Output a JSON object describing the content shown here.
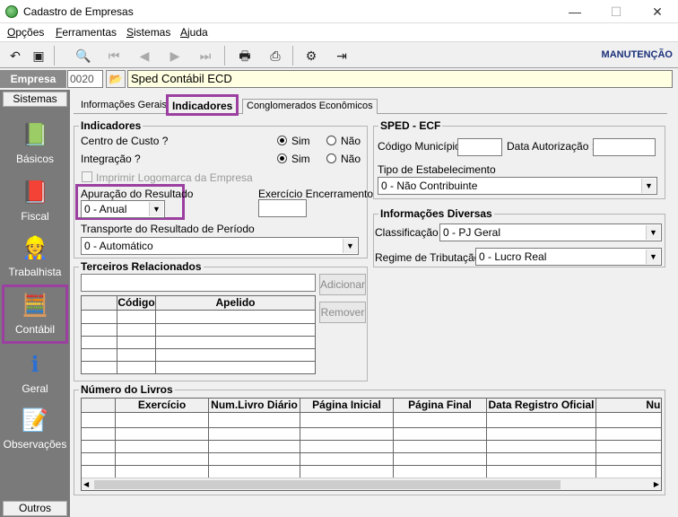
{
  "window": {
    "title": "Cadastro de Empresas",
    "minimize": "—",
    "maximize": "☐",
    "close": "✕"
  },
  "menu": [
    {
      "accel": "O",
      "rest": "pções"
    },
    {
      "accel": "F",
      "rest": "erramentas"
    },
    {
      "accel": "S",
      "rest": "istemas"
    },
    {
      "accel": "A",
      "rest": "juda"
    }
  ],
  "toolbar": {
    "mode": "MANUTENÇÃO"
  },
  "empresa": {
    "label": "Empresa",
    "code": "0020",
    "name": "Sped Contábil ECD"
  },
  "sidebar": {
    "header": "Sistemas",
    "footer": "Outros",
    "items": [
      {
        "label": "Básicos"
      },
      {
        "label": "Fiscal"
      },
      {
        "label": "Trabalhista"
      },
      {
        "label": "Contábil"
      },
      {
        "label": "Geral"
      },
      {
        "label": "Observações"
      }
    ]
  },
  "tabs": [
    "Informações Gerais",
    "Indicadores",
    "Conglomerados Econômicos"
  ],
  "indicadores": {
    "title": "Indicadores",
    "centro_custo": "Centro de Custo ?",
    "integracao": "Integração ?",
    "sim": "Sim",
    "nao": "Não",
    "imprimir": "Imprimir Logomarca da Empresa",
    "apuracao_label": "Apuração do Resultado",
    "apuracao_value": "0 - Anual",
    "exercicio_label": "Exercício Encerramento",
    "transporte_label": "Transporte do Resultado de Período",
    "transporte_value": "0 - Automático"
  },
  "terceiros": {
    "title": "Terceiros Relacionados",
    "col_codigo": "Código",
    "col_apelido": "Apelido",
    "adicionar": "Adicionar",
    "remover": "Remover"
  },
  "sped": {
    "title": "SPED - ECF",
    "cod_municipio": "Código Município :",
    "data_autorizacao": "Data Autorização :",
    "tipo_label": "Tipo de Estabelecimento",
    "tipo_value": "0 - Não Contribuinte"
  },
  "diversas": {
    "title": "Informações Diversas",
    "classificacao_label": "Classificação :",
    "classificacao_value": "0 - PJ Geral",
    "regime_label": "Regime de Tributação :",
    "regime_value": "0 - Lucro Real"
  },
  "livros": {
    "title": "Número do Livros",
    "columns": [
      "Exercício",
      "Num.Livro Diário",
      "Página Inicial",
      "Página Final",
      "Data Registro Oficial",
      "Nur"
    ]
  }
}
